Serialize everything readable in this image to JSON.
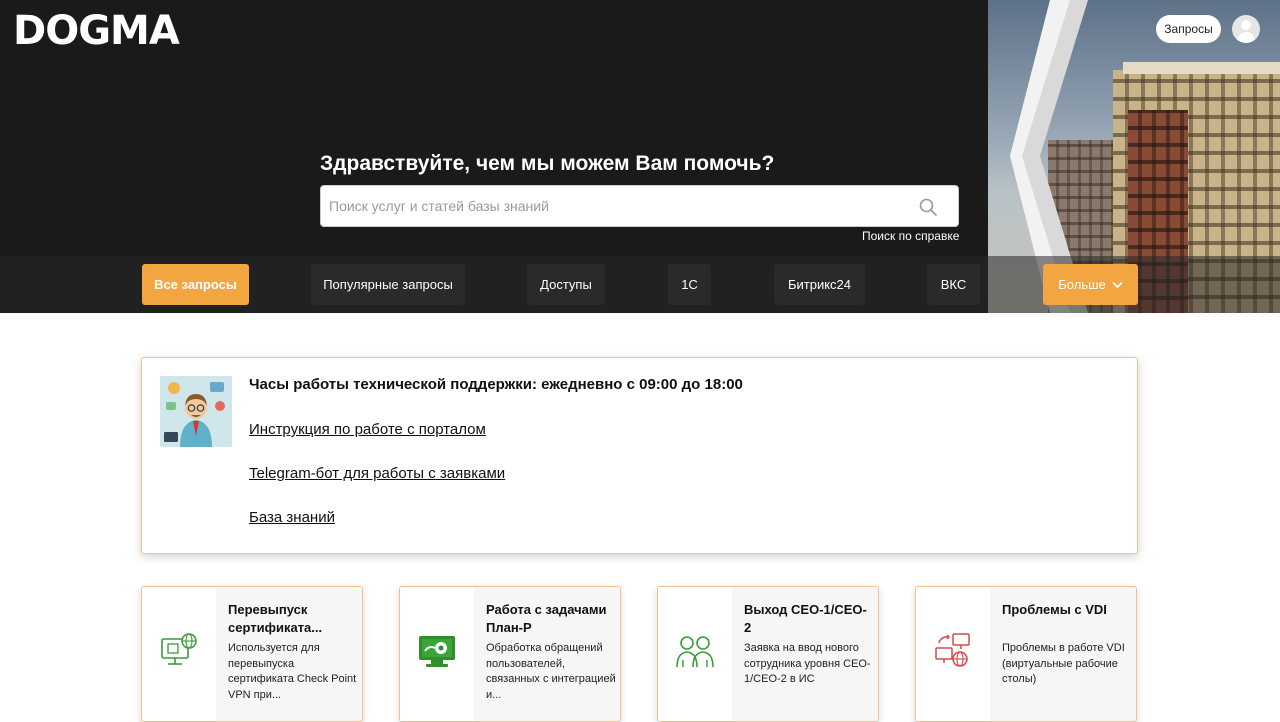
{
  "header": {
    "logo": "DOGMA",
    "requests_button": "Запросы"
  },
  "hero": {
    "greeting": "Здравствуйте, чем мы можем Вам помочь?",
    "search_placeholder": "Поиск услуг и статей базы знаний",
    "search_help": "Поиск по справке"
  },
  "tabs": [
    {
      "label": "Все запросы",
      "active": true
    },
    {
      "label": "Популярные запросы"
    },
    {
      "label": "Доступы"
    },
    {
      "label": "1С"
    },
    {
      "label": "Битрикс24"
    },
    {
      "label": "ВКС"
    },
    {
      "label": "Больше"
    }
  ],
  "info": {
    "title": "Часы работы технической поддержки: ежедневно с 09:00 до 18:00",
    "links": [
      "Инструкция по работе с порталом",
      "Telegram-бот для работы с заявками",
      "База знаний"
    ]
  },
  "services": [
    {
      "title": "Перевыпуск сертификата...",
      "desc": "Используется для перевыпуска сертификата Check Point VPN при...",
      "icon": "computer-globe-icon"
    },
    {
      "title": "Работа с задачами План-Р",
      "desc": "Обработка обращений пользователей, связанных с интеграцией и...",
      "icon": "monitor-gear-icon"
    },
    {
      "title": "Выход CEO-1/CEO-2",
      "desc": "Заявка на ввод нового сотрудника уровня CEO-1/CEO-2 в ИС",
      "icon": "users-icon"
    },
    {
      "title": "Проблемы с VDI",
      "desc": "Проблемы в работе VDI (виртуальные рабочие столы)",
      "icon": "network-sync-icon"
    }
  ],
  "colors": {
    "accent": "#f2a541",
    "hero_bg": "#1a1a1a",
    "service_icon_green": "#3a9a3a",
    "service_icon_red": "#d24b4b"
  }
}
